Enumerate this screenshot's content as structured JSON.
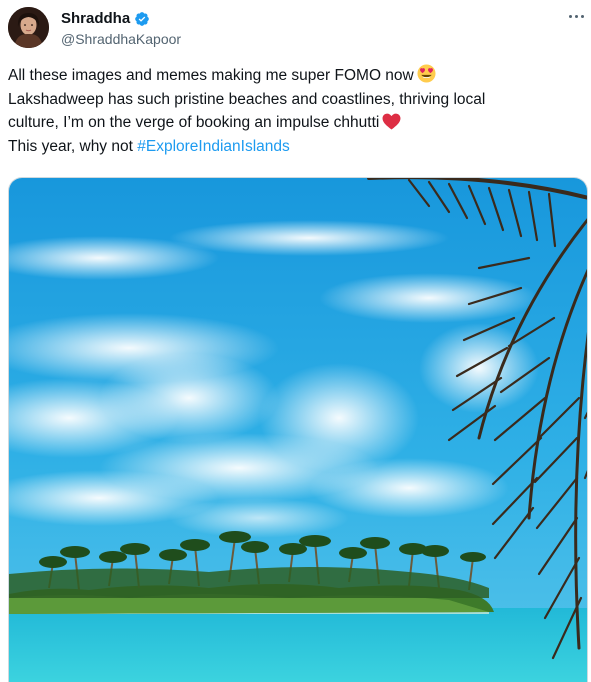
{
  "user": {
    "display_name": "Shraddha",
    "handle": "@ShraddhaKapoor",
    "verified": true
  },
  "tweet": {
    "line1": "All these images and memes making me super FOMO now",
    "line2": "Lakshadweep has such pristine beaches and coastlines, thriving local",
    "line3": "culture, I’m on the verge of booking an impulse chhutti",
    "line4_prefix": "This year, why not ",
    "hashtag": "#ExploreIndianIslands"
  },
  "icons": {
    "verified": "verified-badge-icon",
    "more": "more-options-icon",
    "emoji_1": "smiling-face-with-heart-eyes",
    "emoji_2": "red-heart"
  },
  "colors": {
    "link": "#1d9bf0",
    "verified": "#1d9bf0",
    "secondary_text": "#536471",
    "heart": "#e0245e",
    "sky": "#1fa6e3",
    "sea": "#2ec7d8"
  }
}
